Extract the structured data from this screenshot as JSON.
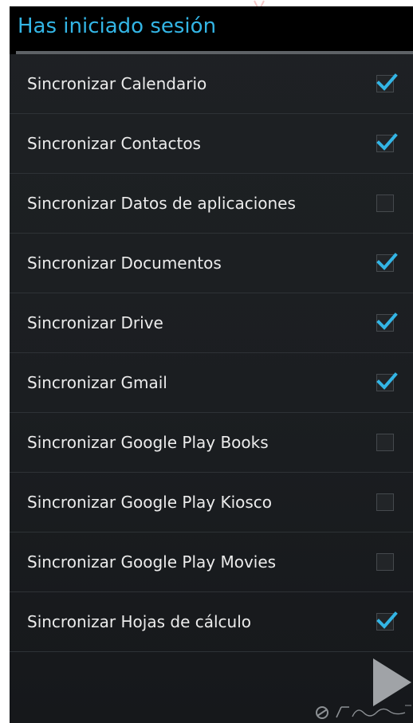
{
  "header": {
    "title": "Has iniciado sesión"
  },
  "sync_items": [
    {
      "label": "Sincronizar Calendario",
      "checked": true
    },
    {
      "label": "Sincronizar Contactos",
      "checked": true
    },
    {
      "label": "Sincronizar Datos de aplicaciones",
      "checked": false
    },
    {
      "label": "Sincronizar Documentos",
      "checked": true
    },
    {
      "label": "Sincronizar Drive",
      "checked": true
    },
    {
      "label": "Sincronizar Gmail",
      "checked": true
    },
    {
      "label": "Sincronizar Google Play Books",
      "checked": false
    },
    {
      "label": "Sincronizar Google Play Kiosco",
      "checked": false
    },
    {
      "label": "Sincronizar Google Play Movies",
      "checked": false
    },
    {
      "label": "Sincronizar Hojas de cálculo",
      "checked": true
    }
  ],
  "icons": {
    "checkbox": "check-icon",
    "next": "play-arrow-icon",
    "watermark_logo": "jetscreenshot-logo"
  },
  "colors": {
    "accent": "#33b5e5",
    "background": "#1b1e21",
    "text": "#ececec"
  }
}
